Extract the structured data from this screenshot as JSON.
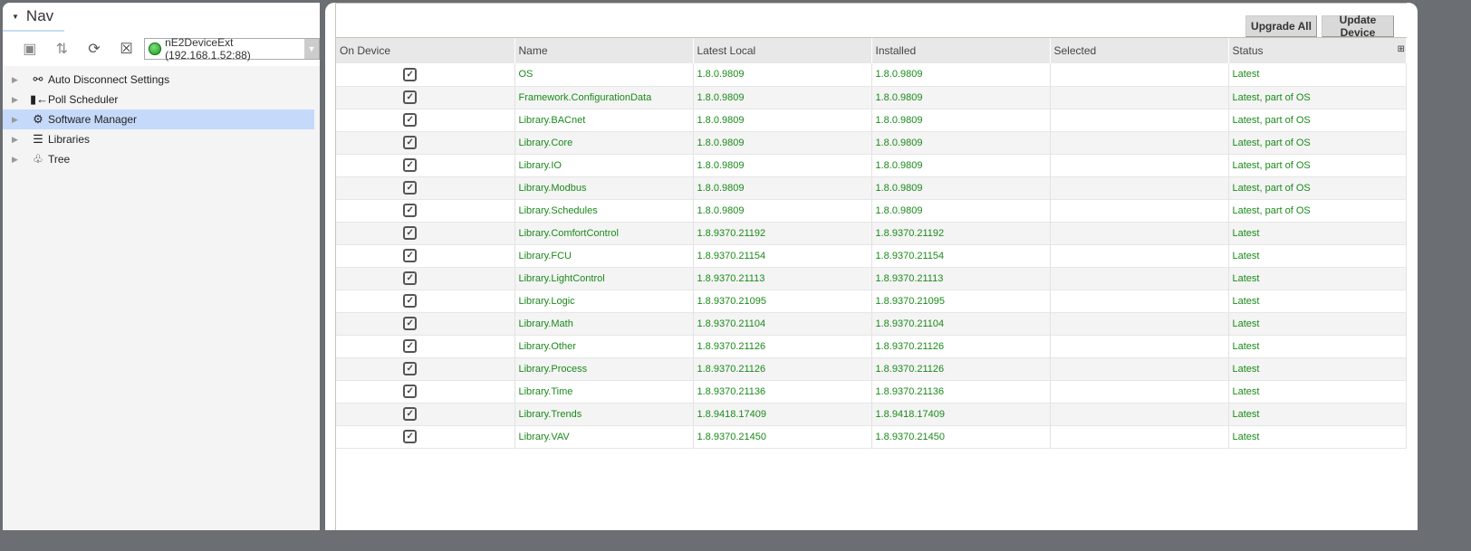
{
  "nav": {
    "tab": "Nav",
    "device": "nE2DeviceExt (192.168.1.52:88)",
    "device_status_color": "#1a9a1a",
    "toolbar": [
      "new-folder-icon",
      "sort-icon",
      "refresh-icon",
      "close-icon"
    ],
    "tree": [
      {
        "label": "Auto Disconnect Settings",
        "icon": "disconnect-icon"
      },
      {
        "label": "Poll Scheduler",
        "icon": "poll-icon"
      },
      {
        "label": "Software Manager",
        "icon": "software-manager-icon",
        "selected": true
      },
      {
        "label": "Libraries",
        "icon": "libraries-icon"
      },
      {
        "label": "Tree",
        "icon": "tree-icon"
      }
    ]
  },
  "main": {
    "buttons": {
      "upgrade_all": "Upgrade All",
      "update_device": "Update Device"
    },
    "columns": [
      "On Device",
      "Name",
      "Latest Local",
      "Installed",
      "Selected",
      "Status"
    ],
    "rows": [
      {
        "on": true,
        "name": "OS",
        "latest": "1.8.0.9809",
        "installed": "1.8.0.9809",
        "selected": "",
        "status": "Latest"
      },
      {
        "on": true,
        "name": "Framework.ConfigurationData",
        "latest": "1.8.0.9809",
        "installed": "1.8.0.9809",
        "selected": "",
        "status": "Latest, part of OS"
      },
      {
        "on": true,
        "name": "Library.BACnet",
        "latest": "1.8.0.9809",
        "installed": "1.8.0.9809",
        "selected": "",
        "status": "Latest, part of OS"
      },
      {
        "on": true,
        "name": "Library.Core",
        "latest": "1.8.0.9809",
        "installed": "1.8.0.9809",
        "selected": "",
        "status": "Latest, part of OS"
      },
      {
        "on": true,
        "name": "Library.IO",
        "latest": "1.8.0.9809",
        "installed": "1.8.0.9809",
        "selected": "",
        "status": "Latest, part of OS"
      },
      {
        "on": true,
        "name": "Library.Modbus",
        "latest": "1.8.0.9809",
        "installed": "1.8.0.9809",
        "selected": "",
        "status": "Latest, part of OS"
      },
      {
        "on": true,
        "name": "Library.Schedules",
        "latest": "1.8.0.9809",
        "installed": "1.8.0.9809",
        "selected": "",
        "status": "Latest, part of OS"
      },
      {
        "on": true,
        "name": "Library.ComfortControl",
        "latest": "1.8.9370.21192",
        "installed": "1.8.9370.21192",
        "selected": "",
        "status": "Latest"
      },
      {
        "on": true,
        "name": "Library.FCU",
        "latest": "1.8.9370.21154",
        "installed": "1.8.9370.21154",
        "selected": "",
        "status": "Latest"
      },
      {
        "on": true,
        "name": "Library.LightControl",
        "latest": "1.8.9370.21113",
        "installed": "1.8.9370.21113",
        "selected": "",
        "status": "Latest"
      },
      {
        "on": true,
        "name": "Library.Logic",
        "latest": "1.8.9370.21095",
        "installed": "1.8.9370.21095",
        "selected": "",
        "status": "Latest"
      },
      {
        "on": true,
        "name": "Library.Math",
        "latest": "1.8.9370.21104",
        "installed": "1.8.9370.21104",
        "selected": "",
        "status": "Latest"
      },
      {
        "on": true,
        "name": "Library.Other",
        "latest": "1.8.9370.21126",
        "installed": "1.8.9370.21126",
        "selected": "",
        "status": "Latest"
      },
      {
        "on": true,
        "name": "Library.Process",
        "latest": "1.8.9370.21126",
        "installed": "1.8.9370.21126",
        "selected": "",
        "status": "Latest"
      },
      {
        "on": true,
        "name": "Library.Time",
        "latest": "1.8.9370.21136",
        "installed": "1.8.9370.21136",
        "selected": "",
        "status": "Latest"
      },
      {
        "on": true,
        "name": "Library.Trends",
        "latest": "1.8.9418.17409",
        "installed": "1.8.9418.17409",
        "selected": "",
        "status": "Latest"
      },
      {
        "on": true,
        "name": "Library.VAV",
        "latest": "1.8.9370.21450",
        "installed": "1.8.9370.21450",
        "selected": "",
        "status": "Latest"
      }
    ],
    "text_color": "#1a8a1a"
  }
}
